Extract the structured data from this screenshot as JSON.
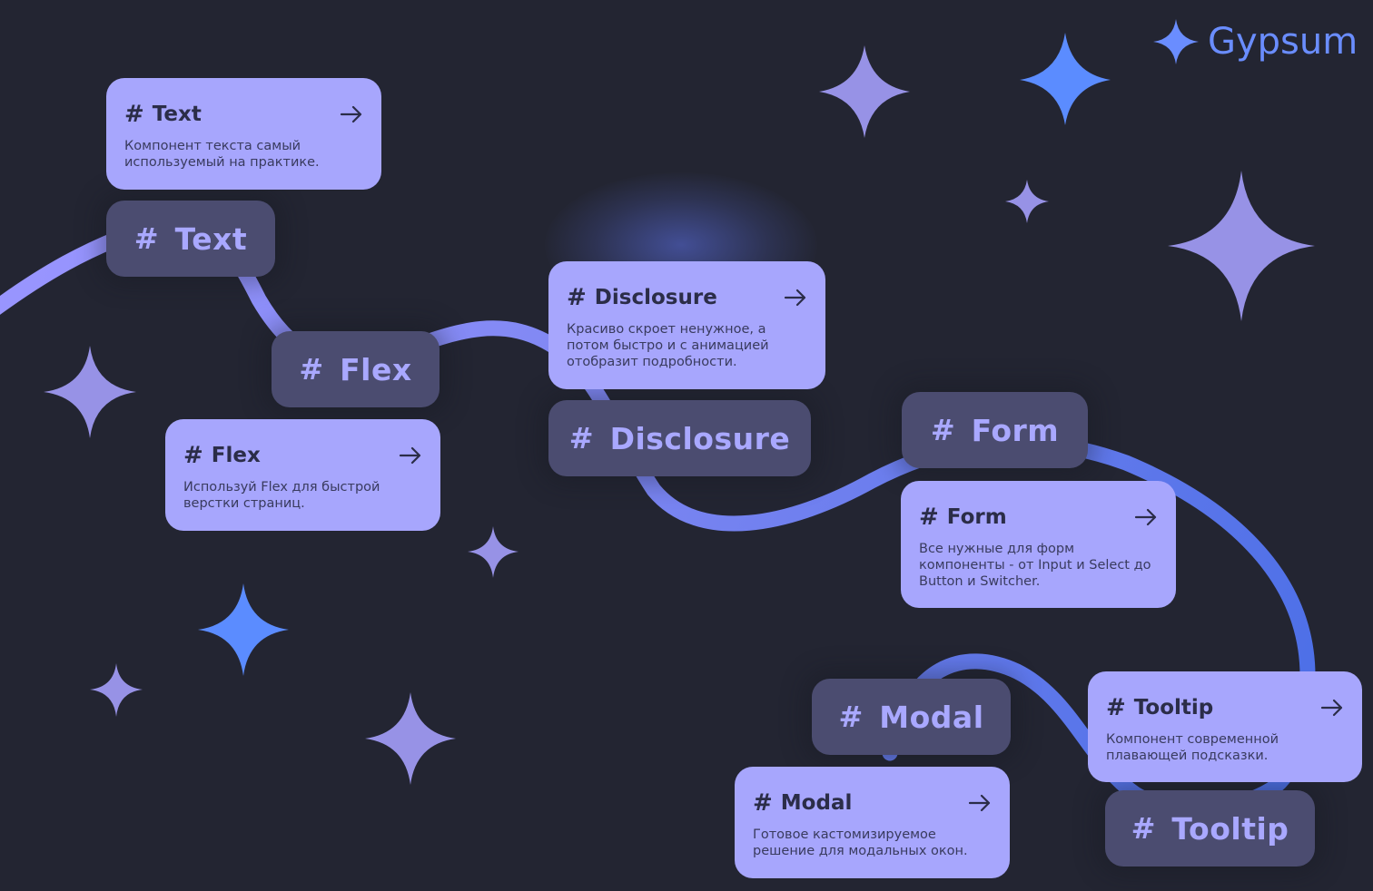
{
  "brand": {
    "name": "Gypsum",
    "icon": "sparkle-icon",
    "color": "#6a8dff"
  },
  "colors": {
    "background": "#232532",
    "card": "#a7a6fd",
    "card_text": "#2b2d48",
    "tag": "#4b4c70",
    "tag_text": "#a9a8ff",
    "path_start": "#9a96ff",
    "path_end": "#4a6ee6",
    "star_violet": "#9792e6",
    "star_blue": "#5b8cff"
  },
  "cards": [
    {
      "name": "Text",
      "description": "Компонент текста самый используемый на практике.",
      "icon": "hash-icon",
      "action_icon": "arrow-right-icon"
    },
    {
      "name": "Flex",
      "description": "Используй Flex для быстрой верстки страниц.",
      "icon": "hash-icon",
      "action_icon": "arrow-right-icon"
    },
    {
      "name": "Disclosure",
      "description": "Красиво скроет ненужное, а потом быстро и с анимацией отобразит подробности.",
      "icon": "hash-icon",
      "action_icon": "arrow-right-icon"
    },
    {
      "name": "Form",
      "description": "Все нужные для форм компоненты - от Input и Select до Button и Switcher.",
      "icon": "hash-icon",
      "action_icon": "arrow-right-icon"
    },
    {
      "name": "Tooltip",
      "description": "Компонент современной плавающей подсказки.",
      "icon": "hash-icon",
      "action_icon": "arrow-right-icon"
    },
    {
      "name": "Modal",
      "description": "Готовое кастомизируемое решение для модальных окон.",
      "icon": "hash-icon",
      "action_icon": "arrow-right-icon"
    }
  ],
  "tags": [
    {
      "label": "Text",
      "hash": "#"
    },
    {
      "label": "Flex",
      "hash": "#"
    },
    {
      "label": "Disclosure",
      "hash": "#"
    },
    {
      "label": "Form",
      "hash": "#"
    },
    {
      "label": "Modal",
      "hash": "#"
    },
    {
      "label": "Tooltip",
      "hash": "#"
    }
  ],
  "decorations": {
    "star_icon": "four-point-star-icon"
  }
}
